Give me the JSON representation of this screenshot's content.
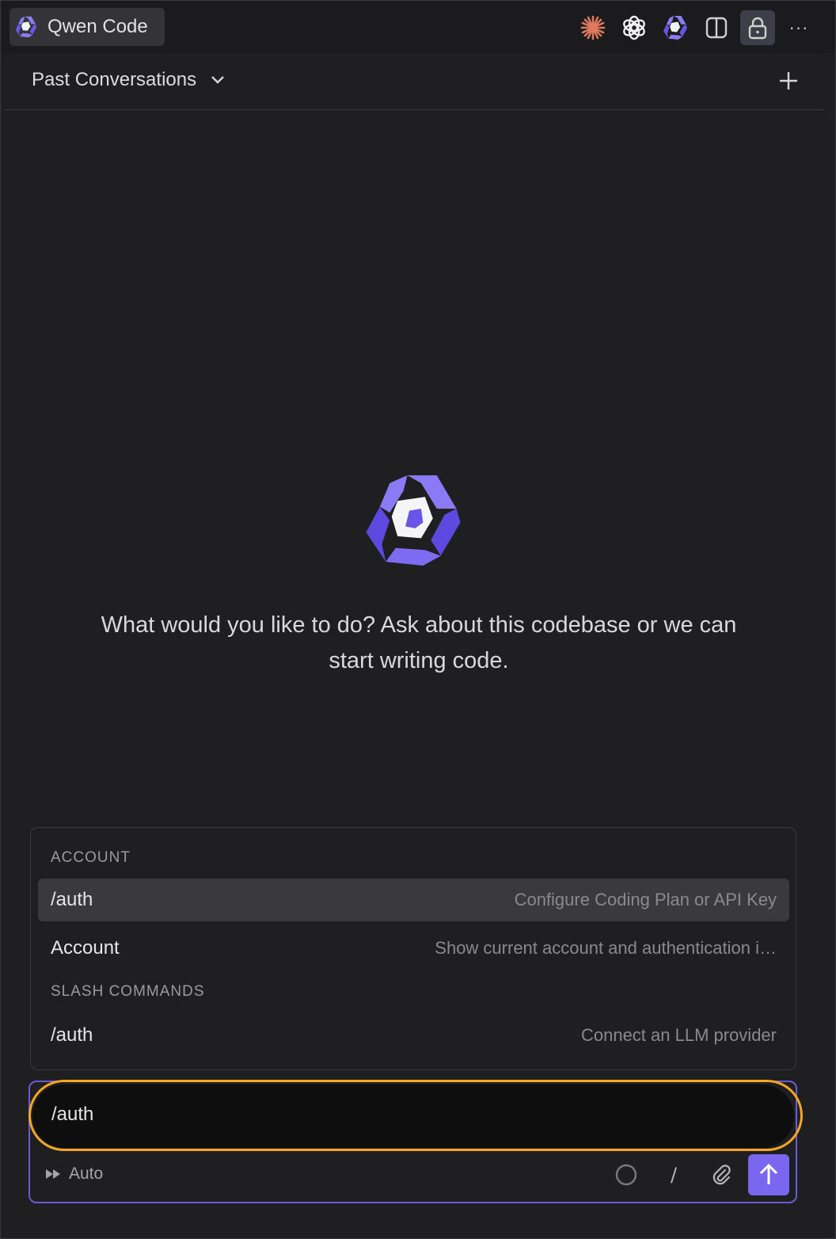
{
  "tab": {
    "label": "Qwen Code",
    "icon": "qwen-logo-icon"
  },
  "toolbar": {
    "icons": [
      "claude-icon",
      "openai-icon",
      "qwen-logo-icon",
      "split-panel-icon",
      "lock-icon",
      "more-icon"
    ],
    "more_label": "···"
  },
  "conversations": {
    "title": "Past Conversations",
    "new_icon": "plus-icon"
  },
  "hero": {
    "message": "What would you like to do? Ask about this codebase or we can start writing code."
  },
  "suggestions": {
    "sections": [
      {
        "label": "ACCOUNT",
        "items": [
          {
            "command": "/auth",
            "description": "Configure Coding Plan or API Key",
            "selected": true
          },
          {
            "command": "Account",
            "description": "Show current account and authentication i…",
            "selected": false
          }
        ]
      },
      {
        "label": "SLASH COMMANDS",
        "items": [
          {
            "command": "/auth",
            "description": "Connect an LLM provider",
            "selected": false
          }
        ]
      }
    ]
  },
  "composer": {
    "value": "/auth",
    "mode_label": "Auto",
    "slash_label": "/"
  },
  "colors": {
    "accent": "#7b66f0",
    "focus_ring": "#f5a623",
    "background": "#1f1f21"
  }
}
